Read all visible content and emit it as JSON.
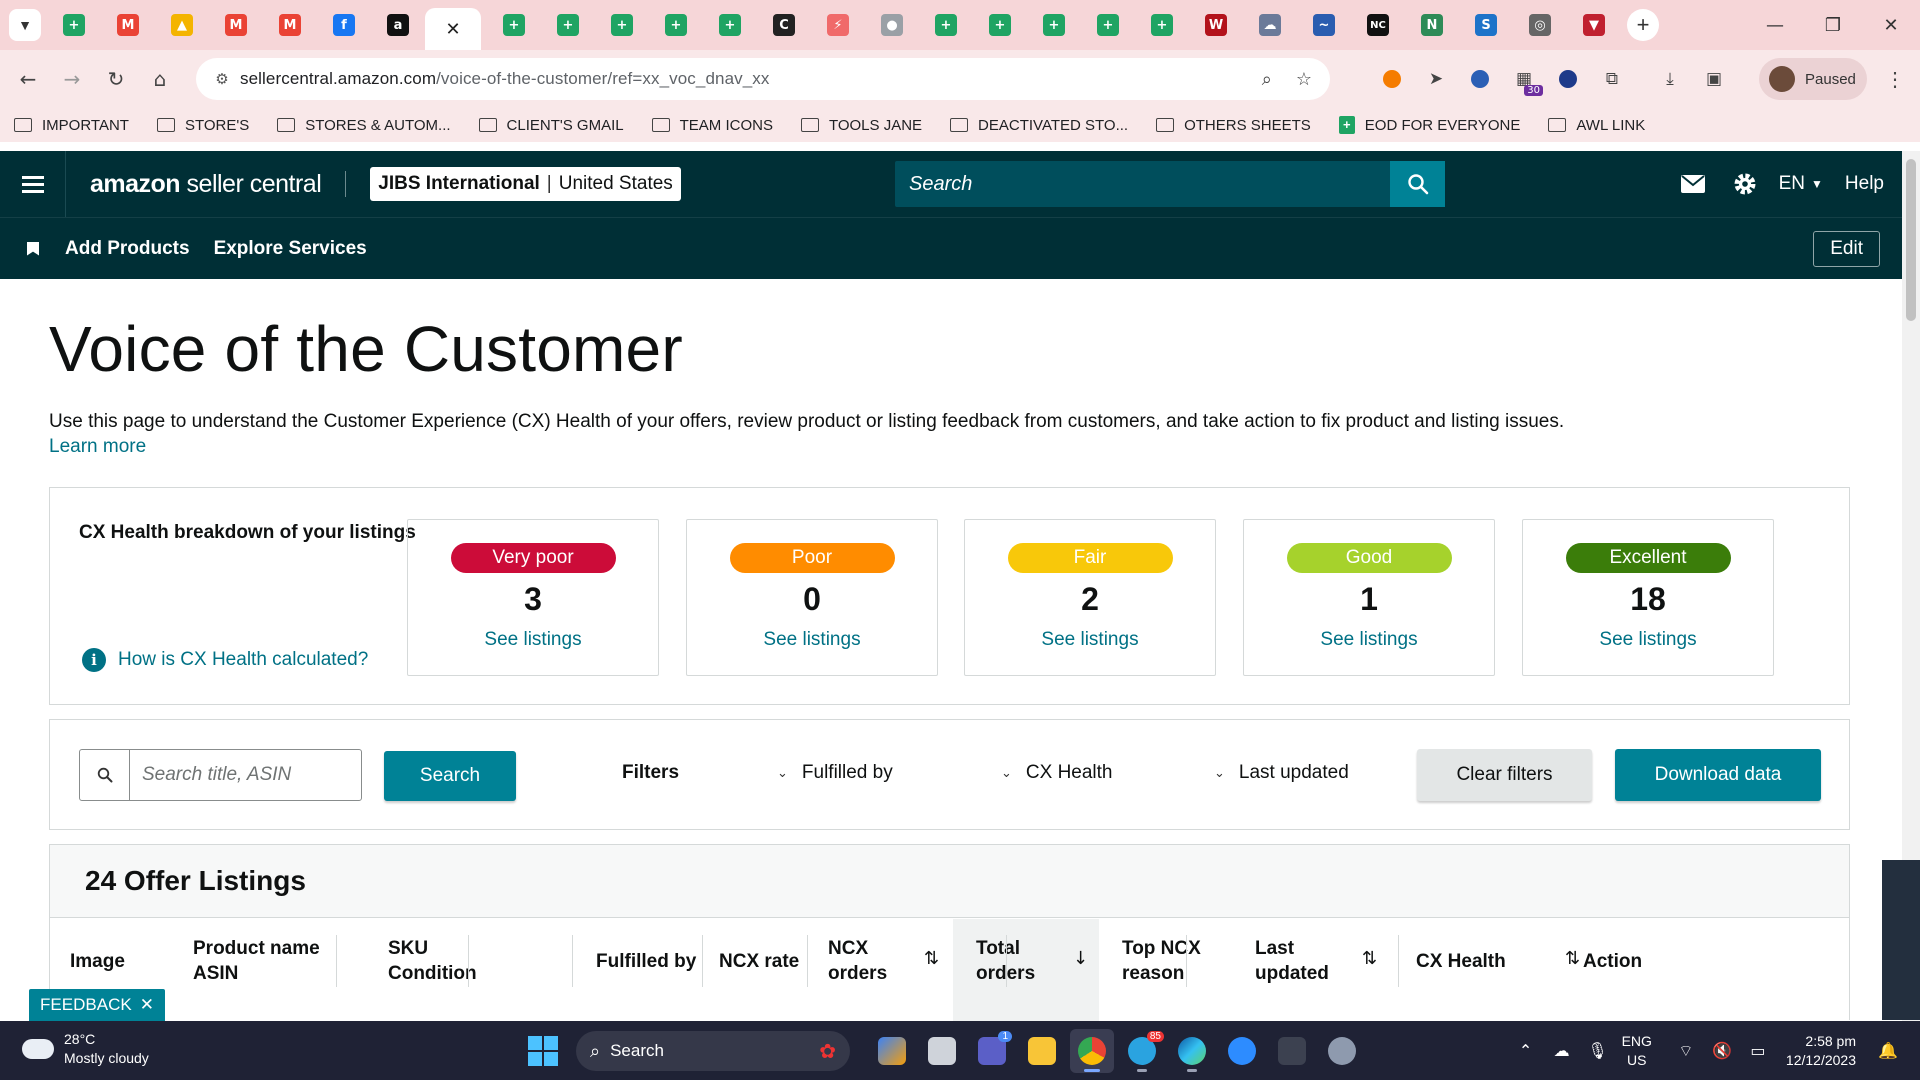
{
  "browser": {
    "tabs": [
      {
        "icon": "google-sheets-icon",
        "color": "#1fa463",
        "glyph": "+"
      },
      {
        "icon": "gmail-icon",
        "color": "#ea4335",
        "glyph": "M"
      },
      {
        "icon": "google-drive-icon",
        "color": "#f4b400",
        "glyph": "▲"
      },
      {
        "icon": "gmail-icon",
        "color": "#ea4335",
        "glyph": "M"
      },
      {
        "icon": "gmail-icon",
        "color": "#ea4335",
        "glyph": "M"
      },
      {
        "icon": "facebook-icon",
        "color": "#1877f2",
        "glyph": "f"
      },
      {
        "icon": "amazon-icon",
        "color": "#111111",
        "glyph": "a"
      }
    ],
    "tabs_after": [
      {
        "icon": "google-sheets-icon",
        "color": "#1fa463",
        "glyph": "+"
      },
      {
        "icon": "google-sheets-icon",
        "color": "#1fa463",
        "glyph": "+"
      },
      {
        "icon": "google-sheets-icon",
        "color": "#1fa463",
        "glyph": "+"
      },
      {
        "icon": "google-sheets-icon",
        "color": "#1fa463",
        "glyph": "+"
      },
      {
        "icon": "google-sheets-icon",
        "color": "#1fa463",
        "glyph": "+"
      },
      {
        "icon": "c-app-icon",
        "color": "#222222",
        "glyph": "C"
      },
      {
        "icon": "clickup-icon",
        "color": "#f06a6a",
        "glyph": "⚡"
      },
      {
        "icon": "globe-icon",
        "color": "#9aa0a6",
        "glyph": "●"
      },
      {
        "icon": "google-sheets-icon",
        "color": "#1fa463",
        "glyph": "+"
      },
      {
        "icon": "google-sheets-icon",
        "color": "#1fa463",
        "glyph": "+"
      },
      {
        "icon": "google-sheets-icon",
        "color": "#1fa463",
        "glyph": "+"
      },
      {
        "icon": "google-sheets-icon",
        "color": "#1fa463",
        "glyph": "+"
      },
      {
        "icon": "google-sheets-icon",
        "color": "#1fa463",
        "glyph": "+"
      },
      {
        "icon": "vw-icon",
        "color": "#b3121b",
        "glyph": "W"
      },
      {
        "icon": "cloud-icon",
        "color": "#6b7a99",
        "glyph": "☁"
      },
      {
        "icon": "swoosh-icon",
        "color": "#2a5db0",
        "glyph": "~"
      },
      {
        "icon": "nc-icon",
        "color": "#111111",
        "glyph": "NC"
      },
      {
        "icon": "n-icon",
        "color": "#2e8b57",
        "glyph": "N"
      },
      {
        "icon": "sysco-icon",
        "color": "#1d73c9",
        "glyph": "S"
      },
      {
        "icon": "circle-logo-icon",
        "color": "#666666",
        "glyph": "◎"
      },
      {
        "icon": "triangle-logo-icon",
        "color": "#c0202f",
        "glyph": "▼"
      }
    ],
    "active_tab_close": "✕",
    "new_tab": "+",
    "url_host": "sellercentral.amazon.com",
    "url_path": "/voice-of-the-customer/ref=xx_voc_dnav_xx",
    "ext_badge": "30",
    "profile_label": "Paused",
    "bookmarks": [
      {
        "type": "folder",
        "label": "IMPORTANT"
      },
      {
        "type": "folder",
        "label": "STORE'S"
      },
      {
        "type": "folder",
        "label": "STORES & AUTOM..."
      },
      {
        "type": "folder",
        "label": "CLIENT'S GMAIL"
      },
      {
        "type": "folder",
        "label": "TEAM ICONS"
      },
      {
        "type": "folder",
        "label": "TOOLS JANE"
      },
      {
        "type": "folder",
        "label": "DEACTIVATED STO..."
      },
      {
        "type": "folder",
        "label": "OTHERS SHEETS"
      },
      {
        "type": "sheet",
        "label": "EOD FOR EVERYONE"
      },
      {
        "type": "folder",
        "label": "AWL LINK"
      }
    ]
  },
  "header": {
    "logo_brand": "amazon",
    "logo_rest": " seller central",
    "account_name": "JIBS International",
    "account_region": "United States",
    "search_placeholder": "Search",
    "language": "EN",
    "help": "Help",
    "nav_links": [
      "Add Products",
      "Explore Services"
    ],
    "edit": "Edit"
  },
  "main": {
    "title": "Voice of the Customer",
    "intro": "Use this page to understand the Customer Experience (CX) Health of your offers, review product or listing feedback from customers, and take action to fix product and listing issues.",
    "learn_more": "Learn more",
    "cx_breakdown_label": "CX Health breakdown of your listings",
    "cx_help_link": "How is CX Health calculated?",
    "cx_cards": [
      {
        "label": "Very poor",
        "count": "3",
        "link": "See listings",
        "color": "#cc0c39"
      },
      {
        "label": "Poor",
        "count": "0",
        "link": "See listings",
        "color": "#ff8c00"
      },
      {
        "label": "Fair",
        "count": "2",
        "link": "See listings",
        "color": "#f8c80a"
      },
      {
        "label": "Good",
        "count": "1",
        "link": "See listings",
        "color": "#a6d22c"
      },
      {
        "label": "Excellent",
        "count": "18",
        "link": "See listings",
        "color": "#3b7d0a"
      }
    ],
    "filters": {
      "search_placeholder": "Search title, ASIN",
      "search_button": "Search",
      "filters_label": "Filters",
      "dropdowns": [
        "Fulfilled by",
        "CX Health",
        "Last updated"
      ],
      "clear": "Clear filters",
      "download": "Download data"
    },
    "listings": {
      "title": "24 Offer Listings",
      "columns": [
        {
          "line1": "Image",
          "line2": ""
        },
        {
          "line1": "Product name",
          "line2": "ASIN"
        },
        {
          "line1": "SKU",
          "line2": "Condition"
        },
        {
          "line1": "Fulfilled by",
          "line2": ""
        },
        {
          "line1": "NCX rate",
          "line2": ""
        },
        {
          "line1": "NCX",
          "line2": "orders"
        },
        {
          "line1": "Total",
          "line2": "orders"
        },
        {
          "line1": "Top NCX",
          "line2": "reason"
        },
        {
          "line1": "Last",
          "line2": "updated"
        },
        {
          "line1": "CX Health",
          "line2": ""
        },
        {
          "line1": "Action",
          "line2": ""
        }
      ]
    },
    "feedback": "FEEDBACK"
  },
  "taskbar": {
    "temperature": "28°C",
    "weather": "Mostly cloudy",
    "search": "Search",
    "lang_line1": "ENG",
    "lang_line2": "US",
    "time": "2:58 pm",
    "date": "12/12/2023",
    "telegram_badge": "85",
    "teams_badge": "1"
  }
}
